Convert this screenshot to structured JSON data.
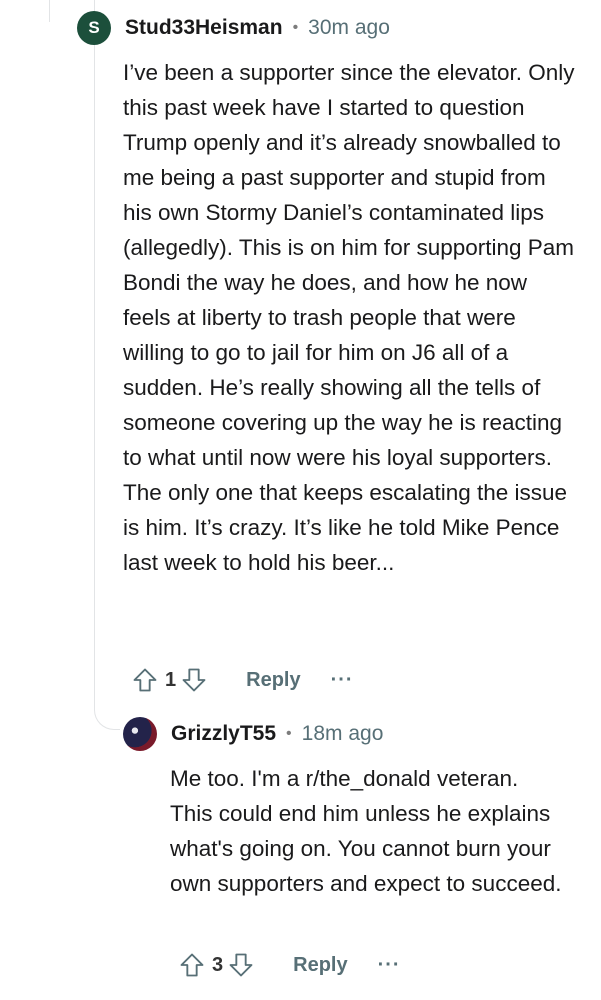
{
  "comments": [
    {
      "avatar_letter": "S",
      "username": "Stud33Heisman",
      "time": "30m ago",
      "body": "I’ve been a supporter since the elevator. Only this past week have I started to question Trump openly and it’s already snowballed to me being a past supporter and stupid from his own Stormy Daniel’s contaminated lips (allegedly). This is on him for supporting Pam Bondi the way he does, and how he now feels at liberty to trash people that were willing to go to jail for him on J6 all of a sudden. He’s really showing all the tells of someone covering up the way he is reacting to what until now were his loyal supporters. The only one that keeps escalating the issue is him. It’s crazy. It’s like he told Mike Pence last week to hold his beer...",
      "score": "1",
      "reply_label": "Reply",
      "more_label": "···"
    },
    {
      "username": "GrizzlyT55",
      "time": "18m ago",
      "body": "Me too. I'm a r/the_donald veteran. This could end him unless he explains what's going on. You cannot burn your own supporters and expect to succeed.",
      "score": "3",
      "reply_label": "Reply",
      "more_label": "···"
    }
  ],
  "separator": "•",
  "icons": {
    "upvote": "arrow-up-outline-icon",
    "downvote": "arrow-down-outline-icon",
    "more": "ellipsis-icon"
  },
  "colors": {
    "avatar_s": "#1c4f3b",
    "meta": "#576f76",
    "text": "#1a1a1b",
    "thread_line": "#e2e4e6"
  }
}
